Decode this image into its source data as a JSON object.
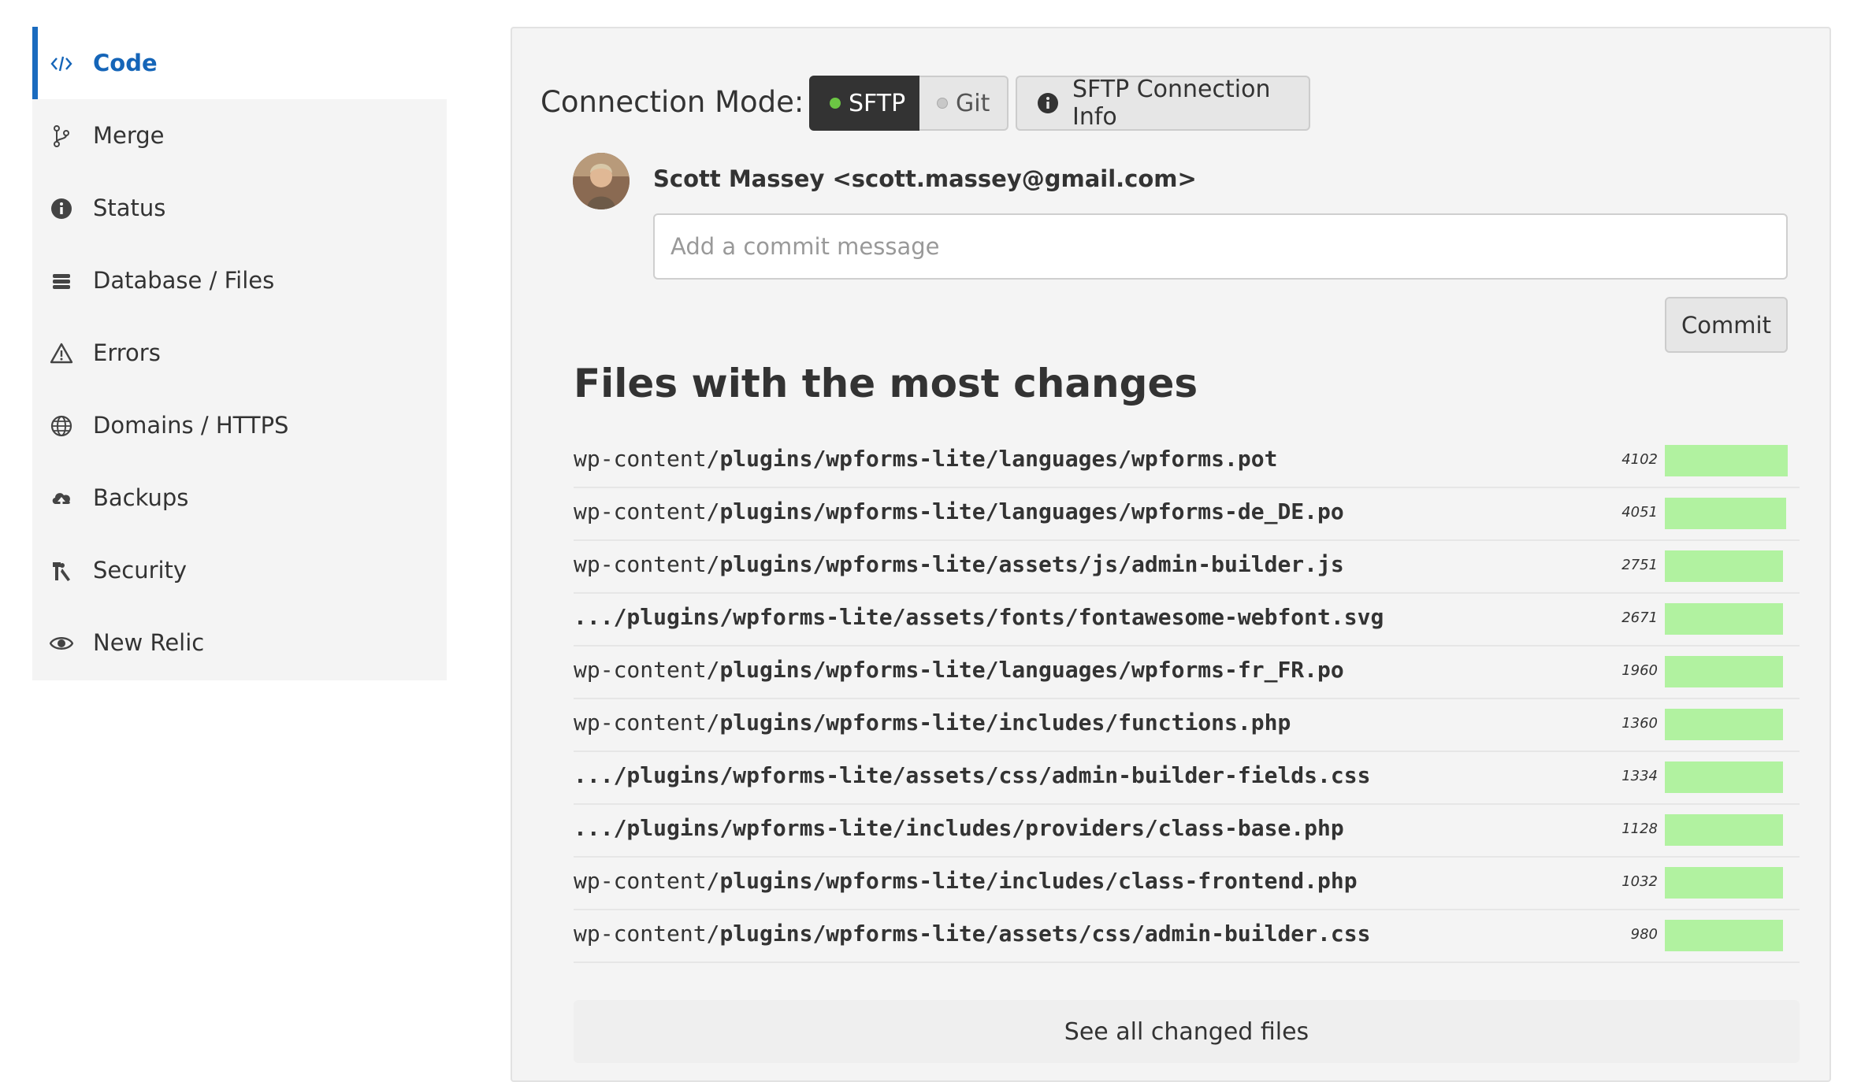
{
  "sidebar": {
    "items": [
      {
        "label": "Code",
        "icon": "code-icon",
        "active": true
      },
      {
        "label": "Merge",
        "icon": "merge-icon"
      },
      {
        "label": "Status",
        "icon": "info-icon"
      },
      {
        "label": "Database / Files",
        "icon": "database-icon"
      },
      {
        "label": "Errors",
        "icon": "warning-icon"
      },
      {
        "label": "Domains / HTTPS",
        "icon": "globe-icon"
      },
      {
        "label": "Backups",
        "icon": "cloud-upload-icon"
      },
      {
        "label": "Security",
        "icon": "security-icon"
      },
      {
        "label": "New Relic",
        "icon": "eye-icon"
      }
    ]
  },
  "connection": {
    "label": "Connection Mode:",
    "sftp_label": "SFTP",
    "git_label": "Git",
    "info_label": "SFTP Connection Info",
    "selected": "SFTP"
  },
  "commit": {
    "author": "Scott Massey <scott.massey@gmail.com>",
    "placeholder": "Add a commit message",
    "button_label": "Commit"
  },
  "files": {
    "heading": "Files with the most changes",
    "see_all_label": "See all changed files",
    "max_count": 4102,
    "rows": [
      {
        "prefix": "wp-content/",
        "rest": "plugins/wpforms-lite/languages/wpforms.pot",
        "count": "4102"
      },
      {
        "prefix": "wp-content/",
        "rest": "plugins/wpforms-lite/languages/wpforms-de_DE.po",
        "count": "4051"
      },
      {
        "prefix": "wp-content/",
        "rest": "plugins/wpforms-lite/assets/js/admin-builder.js",
        "count": "2751"
      },
      {
        "prefix": "",
        "rest": ".../plugins/wpforms-lite/assets/fonts/fontawesome-webfont.svg",
        "count": "2671"
      },
      {
        "prefix": "wp-content/",
        "rest": "plugins/wpforms-lite/languages/wpforms-fr_FR.po",
        "count": "1960"
      },
      {
        "prefix": "wp-content/",
        "rest": "plugins/wpforms-lite/includes/functions.php",
        "count": "1360"
      },
      {
        "prefix": "",
        "rest": ".../plugins/wpforms-lite/assets/css/admin-builder-fields.css",
        "count": "1334"
      },
      {
        "prefix": "",
        "rest": ".../plugins/wpforms-lite/includes/providers/class-base.php",
        "count": "1128"
      },
      {
        "prefix": "wp-content/",
        "rest": "plugins/wpforms-lite/includes/class-frontend.php",
        "count": "1032"
      },
      {
        "prefix": "wp-content/",
        "rest": "plugins/wpforms-lite/assets/css/admin-builder.css",
        "count": "980"
      }
    ]
  },
  "colors": {
    "accent": "#1a6bbf",
    "bar": "#b1f2a0",
    "sftp_active_bg": "#333333",
    "status_green": "#6cc644"
  }
}
